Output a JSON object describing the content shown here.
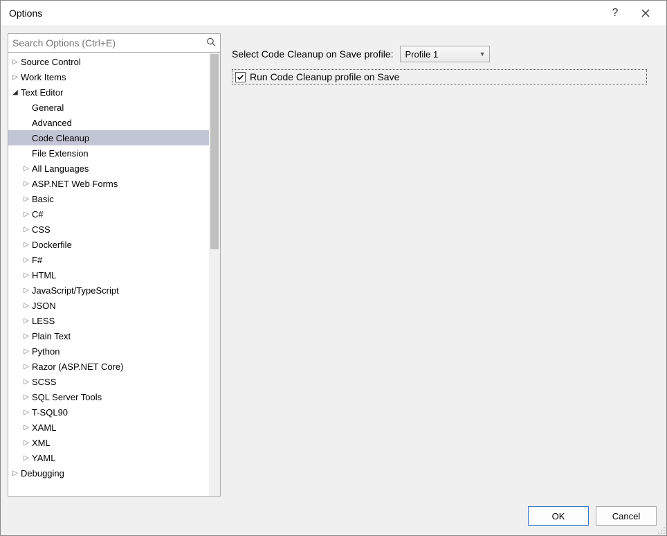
{
  "window": {
    "title": "Options"
  },
  "search": {
    "placeholder": "Search Options (Ctrl+E)"
  },
  "tree": [
    {
      "label": "Source Control",
      "indent": 0,
      "arrow": "collapsed"
    },
    {
      "label": "Work Items",
      "indent": 0,
      "arrow": "collapsed"
    },
    {
      "label": "Text Editor",
      "indent": 0,
      "arrow": "expanded"
    },
    {
      "label": "General",
      "indent": 1,
      "arrow": "none"
    },
    {
      "label": "Advanced",
      "indent": 1,
      "arrow": "none"
    },
    {
      "label": "Code Cleanup",
      "indent": 1,
      "arrow": "none",
      "selected": true
    },
    {
      "label": "File Extension",
      "indent": 1,
      "arrow": "none"
    },
    {
      "label": "All Languages",
      "indent": 1,
      "arrow": "collapsed"
    },
    {
      "label": "ASP.NET Web Forms",
      "indent": 1,
      "arrow": "collapsed"
    },
    {
      "label": "Basic",
      "indent": 1,
      "arrow": "collapsed"
    },
    {
      "label": "C#",
      "indent": 1,
      "arrow": "collapsed"
    },
    {
      "label": "CSS",
      "indent": 1,
      "arrow": "collapsed"
    },
    {
      "label": "Dockerfile",
      "indent": 1,
      "arrow": "collapsed"
    },
    {
      "label": "F#",
      "indent": 1,
      "arrow": "collapsed"
    },
    {
      "label": "HTML",
      "indent": 1,
      "arrow": "collapsed"
    },
    {
      "label": "JavaScript/TypeScript",
      "indent": 1,
      "arrow": "collapsed"
    },
    {
      "label": "JSON",
      "indent": 1,
      "arrow": "collapsed"
    },
    {
      "label": "LESS",
      "indent": 1,
      "arrow": "collapsed"
    },
    {
      "label": "Plain Text",
      "indent": 1,
      "arrow": "collapsed"
    },
    {
      "label": "Python",
      "indent": 1,
      "arrow": "collapsed"
    },
    {
      "label": "Razor (ASP.NET Core)",
      "indent": 1,
      "arrow": "collapsed"
    },
    {
      "label": "SCSS",
      "indent": 1,
      "arrow": "collapsed"
    },
    {
      "label": "SQL Server Tools",
      "indent": 1,
      "arrow": "collapsed"
    },
    {
      "label": "T-SQL90",
      "indent": 1,
      "arrow": "collapsed"
    },
    {
      "label": "XAML",
      "indent": 1,
      "arrow": "collapsed"
    },
    {
      "label": "XML",
      "indent": 1,
      "arrow": "collapsed"
    },
    {
      "label": "YAML",
      "indent": 1,
      "arrow": "collapsed"
    },
    {
      "label": "Debugging",
      "indent": 0,
      "arrow": "collapsed"
    }
  ],
  "main": {
    "profile_label": "Select Code Cleanup on Save profile:",
    "profile_value": "Profile 1",
    "checkbox_label": "Run Code Cleanup profile on Save",
    "checkbox_checked": true
  },
  "buttons": {
    "ok": "OK",
    "cancel": "Cancel"
  }
}
